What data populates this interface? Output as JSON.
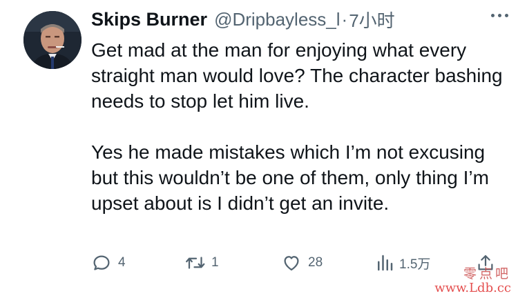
{
  "tweet": {
    "display_name": "Skips Burner",
    "handle": "@Dripbayless_l",
    "separator": "·",
    "time": "7小时",
    "body_paragraphs": [
      "Get mad at the man for enjoying what every straight man would love? The character bashing needs to stop let him live.",
      "Yes he made mistakes which I’m not excusing but this wouldn’t be one of them, only thing I’m upset about is I didn’t get an invite."
    ],
    "avatar_icon": "person-avatar"
  },
  "actions": {
    "reply_count": "4",
    "retweet_count": "1",
    "like_count": "28",
    "views_count": "1.5万",
    "icons": [
      "reply-icon",
      "retweet-icon",
      "like-icon",
      "views-icon",
      "share-icon"
    ]
  },
  "watermark": {
    "top": "零点吧",
    "bottom": "www.Ldb.cc"
  },
  "colors": {
    "text_primary": "#0f1419",
    "text_secondary": "#536471",
    "watermark": "#e03030"
  }
}
